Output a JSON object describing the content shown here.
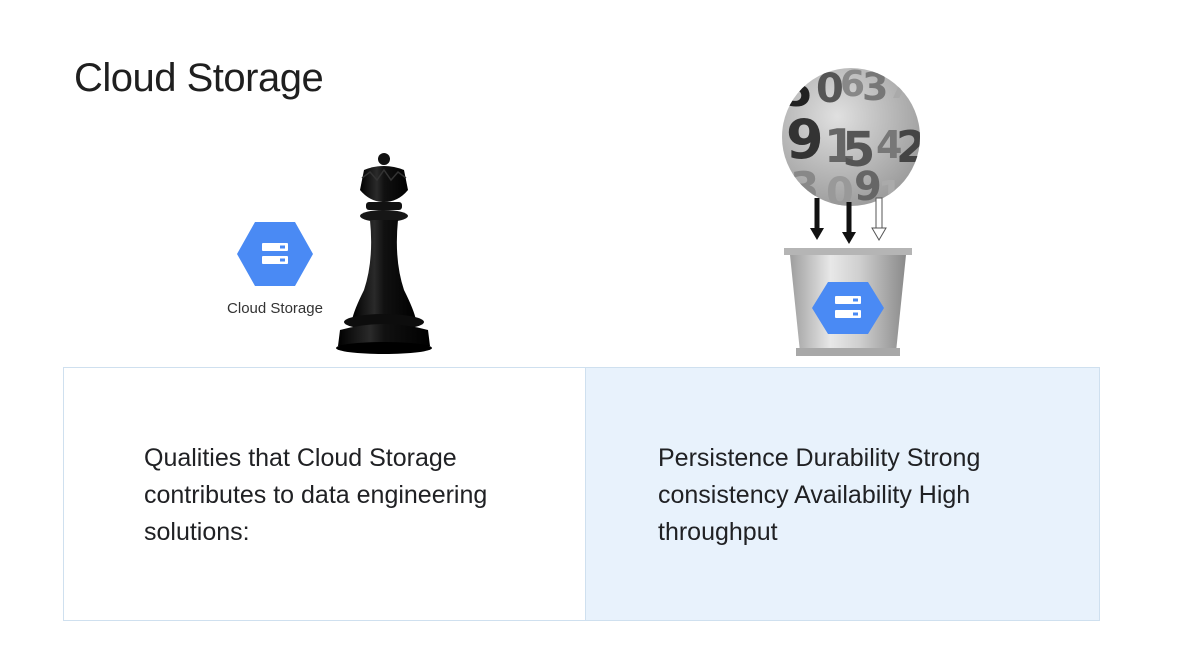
{
  "slide": {
    "title": "Cloud Storage",
    "product_label": "Cloud Storage"
  },
  "icons": {
    "product": "cloud-storage-hexagon-icon",
    "chess": "chess-queen-icon",
    "numbers": "number-sphere-icon",
    "bucket": "storage-bucket-icon",
    "arrows": "down-arrows-icon"
  },
  "table": {
    "left_text": "Qualities that Cloud Storage contributes to data engineering solutions:",
    "right_text": "Persistence Durability Strong consistency Availability High throughput"
  },
  "colors": {
    "hexagon": "#4285f4",
    "right_cell_bg": "#e8f2fc",
    "border": "#cfe0ef"
  }
}
